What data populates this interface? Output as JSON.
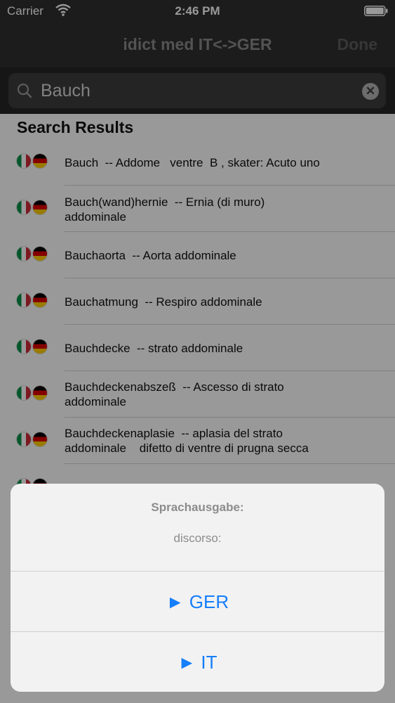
{
  "status_bar": {
    "carrier": "Carrier",
    "time": "2:46 PM"
  },
  "nav": {
    "title": "idict med IT<->GER",
    "done_label": "Done"
  },
  "search": {
    "value": "Bauch"
  },
  "results": {
    "header": "Search Results",
    "rows": [
      {
        "text": "Bauch  -- Addome   ventre  B , skater: Acuto uno"
      },
      {
        "text": "Bauch(wand)hernie  -- Ernia (di muro)\naddominale"
      },
      {
        "text": "Bauchaorta  -- Aorta addominale"
      },
      {
        "text": "Bauchatmung  -- Respiro addominale"
      },
      {
        "text": "Bauchdecke  -- strato addominale"
      },
      {
        "text": "Bauchdeckenabszeß  -- Ascesso di strato\naddominale"
      },
      {
        "text": "Bauchdeckenaplasie  -- aplasia del strato\naddominale    difetto di ventre di prugna secca"
      }
    ]
  },
  "action_sheet": {
    "title": "Sprachausgabe:",
    "message": "discorso:",
    "actions": [
      {
        "label": "► GER"
      },
      {
        "label": "► IT"
      }
    ]
  },
  "colors": {
    "accent": "#157efb",
    "navbar": "#2f2f2f"
  },
  "icons": {
    "wifi": "wifi-icon",
    "battery": "battery-icon",
    "search": "search-icon",
    "clear": "clear-icon",
    "flag_it": "italy-flag-icon",
    "flag_de": "germany-flag-icon"
  }
}
